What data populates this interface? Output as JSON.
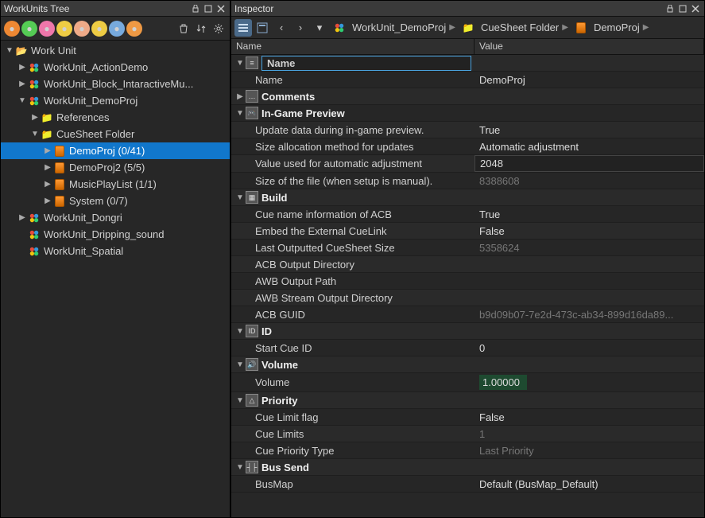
{
  "leftPanel": {
    "title": "WorkUnits Tree",
    "tree": {
      "root": "Work Unit",
      "items": [
        {
          "label": "WorkUnit_ActionDemo",
          "icon": "wu",
          "expand": "closed",
          "depth": 1
        },
        {
          "label": "WorkUnit_Block_IntaractiveMu...",
          "icon": "wu",
          "expand": "closed",
          "depth": 1
        },
        {
          "label": "WorkUnit_DemoProj",
          "icon": "wu",
          "expand": "open",
          "depth": 1
        },
        {
          "label": "References",
          "icon": "folder",
          "expand": "closed",
          "depth": 2
        },
        {
          "label": "CueSheet Folder",
          "icon": "folder",
          "expand": "open",
          "depth": 2
        },
        {
          "label": "DemoProj (0/41)",
          "icon": "cue",
          "expand": "closed",
          "depth": 3,
          "selected": true
        },
        {
          "label": "DemoProj2 (5/5)",
          "icon": "cue",
          "expand": "closed",
          "depth": 3
        },
        {
          "label": "MusicPlayList (1/1)",
          "icon": "cue",
          "expand": "closed",
          "depth": 3
        },
        {
          "label": "System (0/7)",
          "icon": "cue",
          "expand": "closed",
          "depth": 3
        },
        {
          "label": "WorkUnit_Dongri",
          "icon": "wu",
          "expand": "closed",
          "depth": 1
        },
        {
          "label": "WorkUnit_Dripping_sound",
          "icon": "wu",
          "expand": "none",
          "depth": 1
        },
        {
          "label": "WorkUnit_Spatial",
          "icon": "wu",
          "expand": "none",
          "depth": 1
        }
      ]
    }
  },
  "rightPanel": {
    "title": "Inspector",
    "breadcrumb": [
      {
        "label": "WorkUnit_DemoProj",
        "icon": "wu"
      },
      {
        "label": "CueSheet Folder",
        "icon": "folder"
      },
      {
        "label": "DemoProj",
        "icon": "cue"
      }
    ],
    "columns": {
      "name": "Name",
      "value": "Value"
    },
    "groups": [
      {
        "title": "Name",
        "icon": "≡",
        "editing": true,
        "rows": [
          {
            "name": "Name",
            "value": "DemoProj"
          }
        ]
      },
      {
        "title": "Comments",
        "icon": "…",
        "collapsed": true,
        "rows": []
      },
      {
        "title": "In-Game Preview",
        "icon": "🎮",
        "rows": [
          {
            "name": "Update data during in-game preview.",
            "value": "True"
          },
          {
            "name": "Size allocation method for updates",
            "value": "Automatic adjustment"
          },
          {
            "name": "Value used for automatic adjustment",
            "value": "2048",
            "editable": true
          },
          {
            "name": "Size of the file (when setup is manual).",
            "value": "8388608",
            "dim": true
          }
        ]
      },
      {
        "title": "Build",
        "icon": "▦",
        "rows": [
          {
            "name": "Cue name information of ACB",
            "value": "True"
          },
          {
            "name": "Embed the External CueLink",
            "value": "False"
          },
          {
            "name": "Last Outputted CueSheet Size",
            "value": "5358624",
            "dim": true
          },
          {
            "name": "ACB Output Directory",
            "value": ""
          },
          {
            "name": "AWB Output Path",
            "value": ""
          },
          {
            "name": "AWB Stream Output Directory",
            "value": ""
          },
          {
            "name": "ACB GUID",
            "value": "b9d09b07-7e2d-473c-ab34-899d16da89...",
            "dim": true
          }
        ]
      },
      {
        "title": "ID",
        "icon": "ID",
        "rows": [
          {
            "name": "Start Cue ID",
            "value": "0"
          }
        ]
      },
      {
        "title": "Volume",
        "icon": "🔊",
        "rows": [
          {
            "name": "Volume",
            "value": "1.00000",
            "highlight": true
          }
        ]
      },
      {
        "title": "Priority",
        "icon": "△",
        "rows": [
          {
            "name": "Cue Limit flag",
            "value": "False"
          },
          {
            "name": "Cue Limits",
            "value": "1",
            "dim": true
          },
          {
            "name": "Cue Priority Type",
            "value": "Last Priority",
            "dim": true
          }
        ]
      },
      {
        "title": "Bus Send",
        "icon": "┤├",
        "rows": [
          {
            "name": "BusMap",
            "value": "Default (BusMap_Default)"
          }
        ]
      }
    ]
  }
}
